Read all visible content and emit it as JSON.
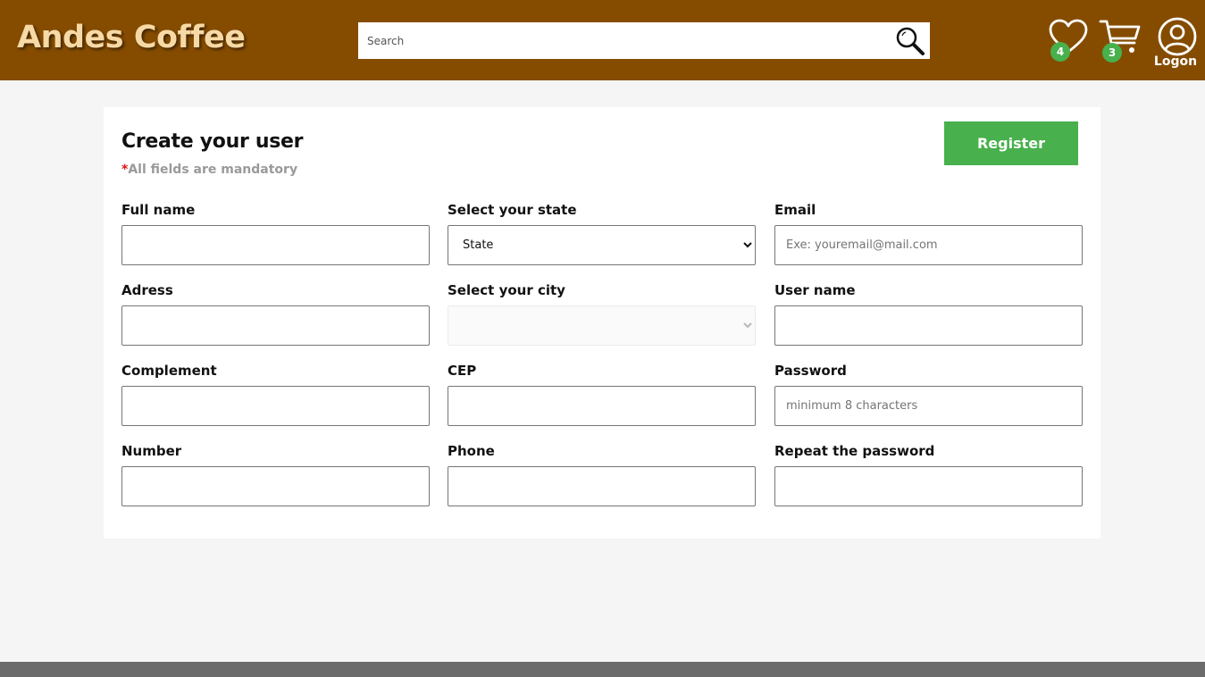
{
  "header": {
    "brand": "Andes Coffee",
    "search_placeholder": "Search",
    "favorites_count": "4",
    "cart_count": "3",
    "logon_label": "Logon",
    "colors": {
      "bar": "#854c00",
      "brand_text": "#f7d9a6",
      "badge": "#48b04c"
    }
  },
  "form": {
    "title": "Create your user",
    "mandatory_star": "*",
    "mandatory_note": "All fields are mandatory",
    "register_label": "Register",
    "fields": {
      "full_name": {
        "label": "Full name",
        "placeholder": ""
      },
      "address": {
        "label": "Adress",
        "placeholder": ""
      },
      "complement": {
        "label": "Complement",
        "placeholder": ""
      },
      "number": {
        "label": "Number",
        "placeholder": ""
      },
      "state": {
        "label": "Select your state",
        "selected": "State"
      },
      "city": {
        "label": "Select your city",
        "selected": ""
      },
      "cep": {
        "label": "CEP",
        "placeholder": ""
      },
      "phone": {
        "label": "Phone",
        "placeholder": ""
      },
      "email": {
        "label": "Email",
        "placeholder": "Exe: youremail@mail.com"
      },
      "user_name": {
        "label": "User name",
        "placeholder": ""
      },
      "password": {
        "label": "Password",
        "placeholder": "minimum 8 characters"
      },
      "repeat_password": {
        "label": "Repeat the password",
        "placeholder": ""
      }
    },
    "colors": {
      "register_button": "#48b04c",
      "mandatory_star": "#dd1111",
      "note_text": "#9a9a9a"
    }
  },
  "icons": {
    "search": "search-icon",
    "favorites": "heart-icon",
    "cart": "cart-icon",
    "logon": "user-circle-icon"
  }
}
